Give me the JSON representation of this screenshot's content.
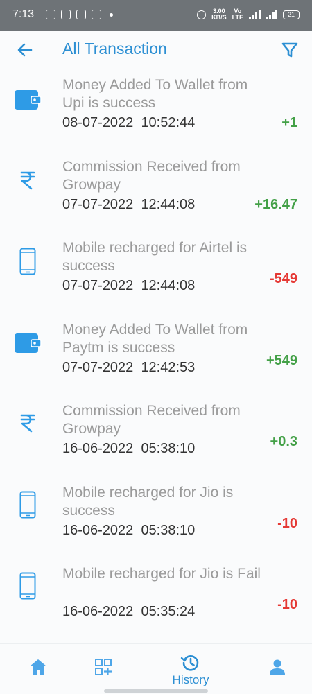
{
  "status_bar": {
    "time": "7:13",
    "network_speed_top": "3.00",
    "network_speed_bottom": "KB/S",
    "volte_label_top": "Vo",
    "volte_label_bottom": "LTE",
    "battery_level": "21"
  },
  "header": {
    "title": "All Transaction"
  },
  "transactions": [
    {
      "icon": "wallet-icon",
      "title": "Money Added To Wallet from Upi is success",
      "date": "08-07-2022",
      "time": "10:52:44",
      "amount": "+1",
      "direction": "credit"
    },
    {
      "icon": "rupee-icon",
      "title": "Commission Received from Growpay",
      "date": "07-07-2022",
      "time": "12:44:08",
      "amount": "+16.47",
      "direction": "credit"
    },
    {
      "icon": "mobile-icon",
      "title": "Mobile recharged for Airtel is success",
      "date": "07-07-2022",
      "time": "12:44:08",
      "amount": "-549",
      "direction": "debit"
    },
    {
      "icon": "wallet-icon",
      "title": "Money Added To Wallet from Paytm is success",
      "date": "07-07-2022",
      "time": "12:42:53",
      "amount": "+549",
      "direction": "credit"
    },
    {
      "icon": "rupee-icon",
      "title": "Commission Received from Growpay",
      "date": "16-06-2022",
      "time": "05:38:10",
      "amount": "+0.3",
      "direction": "credit"
    },
    {
      "icon": "mobile-icon",
      "title": "Mobile recharged for Jio is success",
      "date": "16-06-2022",
      "time": "05:38:10",
      "amount": "-10",
      "direction": "debit"
    },
    {
      "icon": "mobile-icon",
      "title": "Mobile recharged for Jio is Fail",
      "date": "16-06-2022",
      "time": "05:35:24",
      "amount": "-10",
      "direction": "debit"
    }
  ],
  "bottom_nav": {
    "home": {
      "icon": "home-icon"
    },
    "services": {
      "icon": "services-grid-icon"
    },
    "history": {
      "icon": "history-icon",
      "label": "History",
      "active": true
    },
    "profile": {
      "icon": "profile-icon"
    }
  },
  "colors": {
    "accent": "#2c8fd3",
    "credit": "#43a047",
    "debit": "#e53935",
    "title_text": "#9a9a9a",
    "datetime_text": "#333333"
  }
}
